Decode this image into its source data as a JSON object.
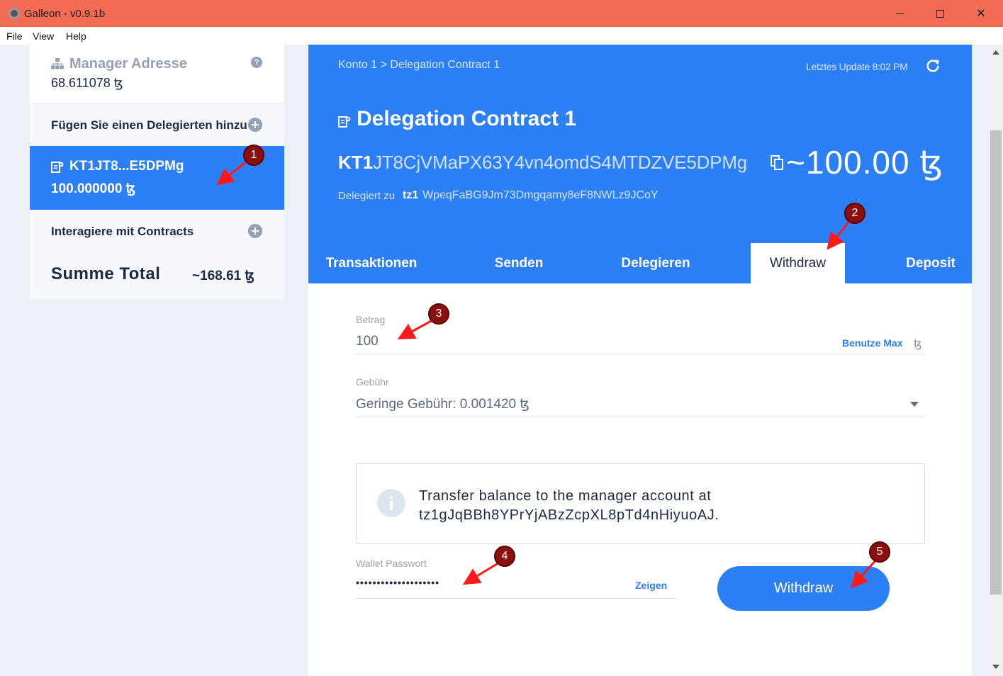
{
  "window": {
    "title": "Galleon - v0.9.1b",
    "controls": {
      "minimize": "minimize",
      "maximize": "maximize",
      "close": "✕"
    }
  },
  "menu": {
    "file": "File",
    "view": "View",
    "help": "Help"
  },
  "sidebar": {
    "manager": {
      "label": "Manager Adresse",
      "balance": "68.611078 ꜩ",
      "help_icon": "?"
    },
    "add_delegate": {
      "label": "Fügen Sie einen Delegierten hinzu"
    },
    "selected_contract": {
      "address": "KT1JT8...E5DPMg",
      "balance": "100.000000 ꜩ"
    },
    "interact": {
      "label": "Interagiere mit Contracts"
    },
    "total": {
      "label": "Summe Total",
      "value": "~168.61 ꜩ"
    }
  },
  "main": {
    "breadcrumb": "Konto 1 > Delegation Contract 1",
    "last_update": "Letztes Update 8:02 PM",
    "title": "Delegation Contract 1",
    "address_prefix": "KT1",
    "address_rest": "JT8CjVMaPX63Y4vn4omdS4MTDZVE5DPMg",
    "amount": "~100.00 ꜩ",
    "delegated_label": "Delegiert zu",
    "delegated_prefix": "tz1",
    "delegated_rest": "WpeqFaBG9Jm73Dmgqamy8eF8NWLz9JCoY",
    "tabs": [
      {
        "label": "Transaktionen",
        "active": false
      },
      {
        "label": "Senden",
        "active": false
      },
      {
        "label": "Delegieren",
        "active": false
      },
      {
        "label": "Withdraw",
        "active": true
      },
      {
        "label": "Deposit",
        "active": false
      }
    ],
    "form": {
      "amount_label": "Betrag",
      "amount_value": "100",
      "use_max": "Benutze Max",
      "tez_symbol": "ꜩ",
      "fee_label": "Gebühr",
      "fee_value": "Geringe Gebühr: 0.001420 ꜩ",
      "info_line1": "Transfer balance to the manager account at",
      "info_line2": "tz1gJqBBh8YPrYjABzZcpXL8pTd4nHiyuoAJ.",
      "password_label": "Wallet Passwort",
      "password_value": "••••••••••••••••••••",
      "show_label": "Zeigen",
      "submit_label": "Withdraw"
    }
  },
  "annotations": [
    "1",
    "2",
    "3",
    "4",
    "5"
  ],
  "colors": {
    "accent": "#2c7ff5",
    "titlebar": "#f26c55",
    "annotation": "#8b0f0f",
    "arrow": "#ff0000"
  }
}
